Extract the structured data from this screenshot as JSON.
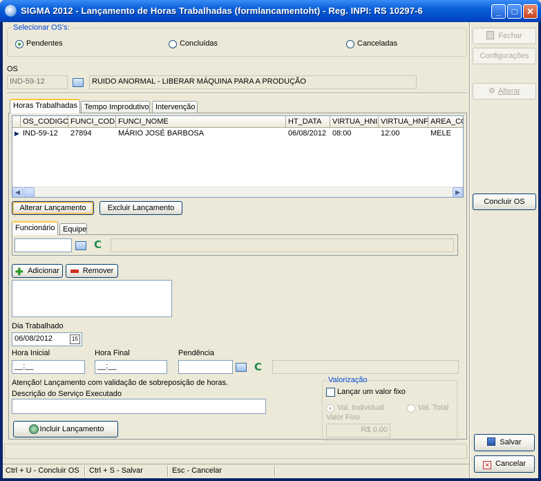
{
  "window": {
    "title": "SIGMA 2012 - Lançamento de Horas Trabalhadas  (formlancamentoht)  - Reg. INPI: RS 10297-6"
  },
  "os_selection": {
    "group_label": "Selecionar OS's:",
    "options": [
      "Pendentes",
      "Concluídas",
      "Canceladas"
    ],
    "selected": "Pendentes"
  },
  "os": {
    "label": "OS",
    "code": "IND-59-12",
    "description": "RUIDO ANORMAL - LIBERAR MÁQUINA PARA A PRODUÇÃO"
  },
  "tabs": [
    "Horas Trabalhadas",
    "Tempo Improdutivo",
    "Intervenção"
  ],
  "grid": {
    "columns": [
      "OS_CODIGO",
      "FUNCI_CODI",
      "FUNCI_NOME",
      "HT_DATA",
      "VIRTUA_HNI",
      "VIRTUA_HNF",
      "AREA_CO"
    ],
    "rows": [
      [
        "IND-59-12",
        "27894",
        "MÁRIO JOSÉ BARBOSA",
        "06/08/2012",
        "08:00",
        "12:00",
        "MELE"
      ]
    ]
  },
  "grid_buttons": {
    "alter": "Alterar Lançamento",
    "delete": "Excluir Lançamento"
  },
  "sub_tabs": [
    "Funcionário",
    "Equipe"
  ],
  "employee": {
    "code_value": "",
    "name_value": ""
  },
  "list_buttons": {
    "add": "Adicionar",
    "remove": "Remover"
  },
  "dia_trabalhado": {
    "label": "Dia Trabalhado",
    "value": "06/08/2012"
  },
  "hora_inicial": {
    "label": "Hora Inicial",
    "value": "__:__"
  },
  "hora_final": {
    "label": "Hora Final",
    "value": "__:__"
  },
  "pendencia": {
    "label": "Pendência",
    "value": ""
  },
  "warning": "Atenção! Lançamento com validação de sobreposição de horas.",
  "descricao": {
    "label": "Descrição do Serviço Executado",
    "value": ""
  },
  "incluir_button": "Incluir Lançamento",
  "valorizacao": {
    "group_label": "Valorização",
    "checkbox_label": "Lançar um valor fixo",
    "radio_individual": "Val. Individual",
    "radio_total": "Val. Total",
    "valor_label": "Valor Fixo",
    "valor_value": "R$ 0,00"
  },
  "right_panel": {
    "fechar": "Fechar",
    "configuracoes": "Configurações",
    "alterar": "Alterar",
    "concluir": "Concluir OS",
    "salvar": "Salvar",
    "cancelar": "Cancelar"
  },
  "status_bar": [
    "Ctrl + U - Concluir OS",
    "Ctrl + S - Salvar",
    "Esc - Cancelar"
  ],
  "colors": {
    "title_bar": "#0048c8",
    "group_label": "#0046d5",
    "accent_c": "#1a8a4a"
  }
}
